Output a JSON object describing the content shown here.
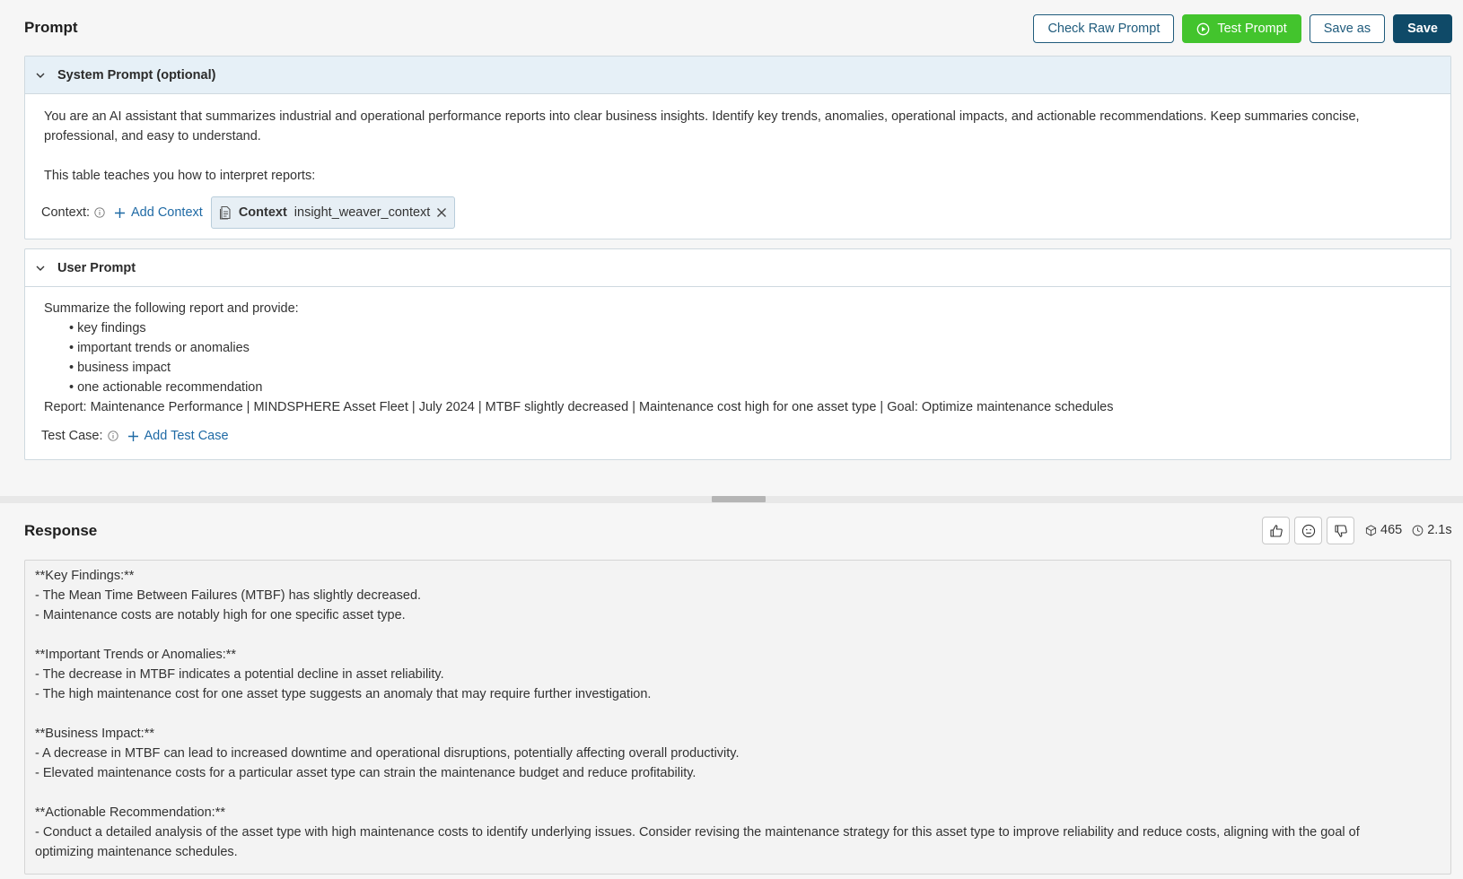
{
  "header": {
    "title": "Prompt",
    "check_raw_label": "Check Raw Prompt",
    "test_label": "Test Prompt",
    "save_as_label": "Save as",
    "save_label": "Save"
  },
  "system_prompt": {
    "title": "System Prompt (optional)",
    "text": "You are an AI assistant that summarizes industrial and operational performance reports into clear business insights. Identify key trends, anomalies, operational impacts, and actionable recommendations. Keep summaries concise, professional, and easy to understand.",
    "text2": "This table teaches you how to interpret reports:",
    "context_label": "Context:",
    "add_context_label": "Add Context",
    "chip_key": "Context",
    "chip_value": "insight_weaver_context"
  },
  "user_prompt": {
    "title": "User Prompt",
    "intro": "Summarize the following report and provide:",
    "bullets": [
      "key findings",
      "important trends or anomalies",
      "business impact",
      "one actionable recommendation"
    ],
    "report": "Report: Maintenance Performance | MINDSPHERE Asset Fleet | July 2024 | MTBF slightly decreased | Maintenance cost high for one asset type | Goal: Optimize maintenance schedules",
    "test_case_label": "Test Case:",
    "add_test_case_label": "Add Test Case"
  },
  "response": {
    "title": "Response",
    "tokens": "465",
    "time": "2.1s",
    "text": "**Key Findings:**\n- The Mean Time Between Failures (MTBF) has slightly decreased.\n- Maintenance costs are notably high for one specific asset type.\n\n**Important Trends or Anomalies:**\n- The decrease in MTBF indicates a potential decline in asset reliability.\n- The high maintenance cost for one asset type suggests an anomaly that may require further investigation.\n\n**Business Impact:**\n- A decrease in MTBF can lead to increased downtime and operational disruptions, potentially affecting overall productivity.\n- Elevated maintenance costs for a particular asset type can strain the maintenance budget and reduce profitability.\n\n**Actionable Recommendation:**\n- Conduct a detailed analysis of the asset type with high maintenance costs to identify underlying issues. Consider revising the maintenance strategy for this asset type to improve reliability and reduce costs, aligning with the goal of\noptimizing maintenance schedules."
  },
  "icons": {
    "chevron": "chevron-down-icon",
    "play": "play-circle-icon",
    "info": "info-icon",
    "plus": "plus-icon",
    "doc": "document-icon",
    "close": "close-icon",
    "thumbs_up": "thumbs-up-icon",
    "neutral": "neutral-face-icon",
    "thumbs_down": "thumbs-down-icon",
    "tokens": "cube-icon",
    "clock": "clock-icon"
  },
  "colors": {
    "accent": "#1f5b7c",
    "primary_dark": "#0f4a68",
    "green": "#43c42d",
    "link": "#1f6aa5",
    "panel_header_blue": "#e6f0f7"
  }
}
